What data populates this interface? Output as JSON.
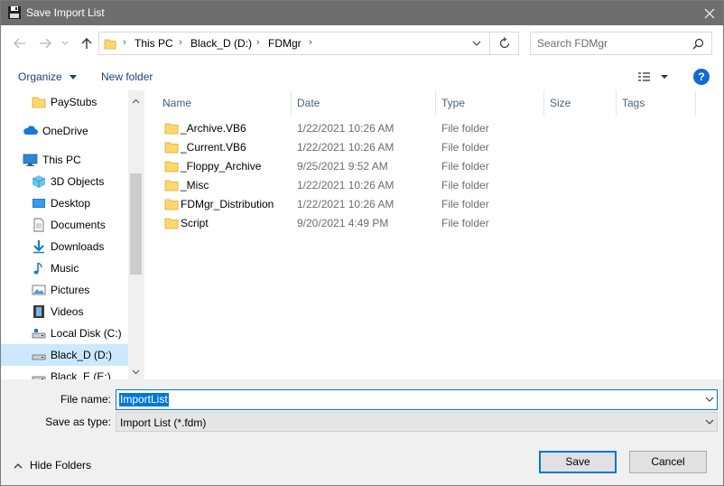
{
  "window": {
    "title": "Save Import List"
  },
  "address": {
    "crumbs": [
      "This PC",
      "Black_D (D:)",
      "FDMgr"
    ]
  },
  "search": {
    "placeholder": "Search FDMgr"
  },
  "commands": {
    "organize": "Organize",
    "new_folder": "New folder"
  },
  "nav": {
    "items": [
      {
        "label": "PayStubs",
        "icon": "folder-icon"
      },
      {
        "label": "OneDrive",
        "icon": "cloud-icon"
      },
      {
        "label": "This PC",
        "icon": "computer-icon"
      },
      {
        "label": "3D Objects",
        "icon": "cube-icon"
      },
      {
        "label": "Desktop",
        "icon": "desktop-icon"
      },
      {
        "label": "Documents",
        "icon": "document-icon"
      },
      {
        "label": "Downloads",
        "icon": "download-icon"
      },
      {
        "label": "Music",
        "icon": "music-icon"
      },
      {
        "label": "Pictures",
        "icon": "picture-icon"
      },
      {
        "label": "Videos",
        "icon": "video-icon"
      },
      {
        "label": "Local Disk (C:)",
        "icon": "drive-icon"
      },
      {
        "label": "Black_D (D:)",
        "icon": "drive-icon",
        "selected": true
      },
      {
        "label": "Black_E (E:)",
        "icon": "drive-icon"
      }
    ]
  },
  "columns": {
    "name": "Name",
    "date": "Date",
    "type": "Type",
    "size": "Size",
    "tags": "Tags"
  },
  "files": [
    {
      "name": "_Archive.VB6",
      "date": "1/22/2021 10:26 AM",
      "type": "File folder"
    },
    {
      "name": "_Current.VB6",
      "date": "1/22/2021 10:26 AM",
      "type": "File folder"
    },
    {
      "name": "_Floppy_Archive",
      "date": "9/25/2021 9:52 AM",
      "type": "File folder"
    },
    {
      "name": "_Misc",
      "date": "1/22/2021 10:26 AM",
      "type": "File folder"
    },
    {
      "name": "FDMgr_Distribution",
      "date": "1/22/2021 10:26 AM",
      "type": "File folder"
    },
    {
      "name": "Script",
      "date": "9/20/2021 4:49 PM",
      "type": "File folder"
    }
  ],
  "form": {
    "file_name_label": "File name:",
    "file_name_value": "ImportList",
    "save_type_label": "Save as type:",
    "save_type_value": "Import List (*.fdm)"
  },
  "footer": {
    "hide_folders": "Hide Folders",
    "save": "Save",
    "cancel": "Cancel"
  },
  "colors": {
    "accent": "#0078d7",
    "titlebar": "#6e6e6e",
    "selected_nav": "#cce8ff",
    "folder": "#ffd86b"
  }
}
